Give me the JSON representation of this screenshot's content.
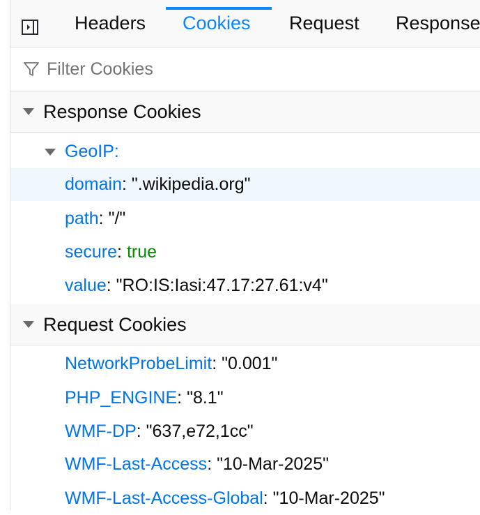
{
  "tabs": [
    {
      "label": "Headers",
      "active": false
    },
    {
      "label": "Cookies",
      "active": true
    },
    {
      "label": "Request",
      "active": false
    },
    {
      "label": "Response",
      "active": false
    }
  ],
  "filter": {
    "placeholder": "Filter Cookies",
    "value": ""
  },
  "response_cookies": {
    "title": "Response Cookies",
    "cookie": {
      "name": "GeoIP",
      "name_suffix": ":",
      "props": [
        {
          "key": "domain",
          "value": "\".wikipedia.org\"",
          "type": "string"
        },
        {
          "key": "path",
          "value": "\"/\"",
          "type": "string"
        },
        {
          "key": "secure",
          "value": "true",
          "type": "bool"
        },
        {
          "key": "value",
          "value": "\"RO:IS:Iasi:47.17:27.61:v4\"",
          "type": "string"
        }
      ]
    }
  },
  "request_cookies": {
    "title": "Request Cookies",
    "items": [
      {
        "key": "NetworkProbeLimit",
        "value": "\"0.001\""
      },
      {
        "key": "PHP_ENGINE",
        "value": "\"8.1\""
      },
      {
        "key": "WMF-DP",
        "value": "\"637,e72,1cc\""
      },
      {
        "key": "WMF-Last-Access",
        "value": "\"10-Mar-2025\""
      },
      {
        "key": "WMF-Last-Access-Global",
        "value": "\"10-Mar-2025\""
      }
    ]
  },
  "colors": {
    "accent": "#0a84ff",
    "key": "#0074e8",
    "bool": "#058b00",
    "highlight": "#f0f7ff"
  },
  "icons": {
    "sidebar_toggle": "sidebar-toggle-icon",
    "filter": "filter-funnel-icon"
  }
}
